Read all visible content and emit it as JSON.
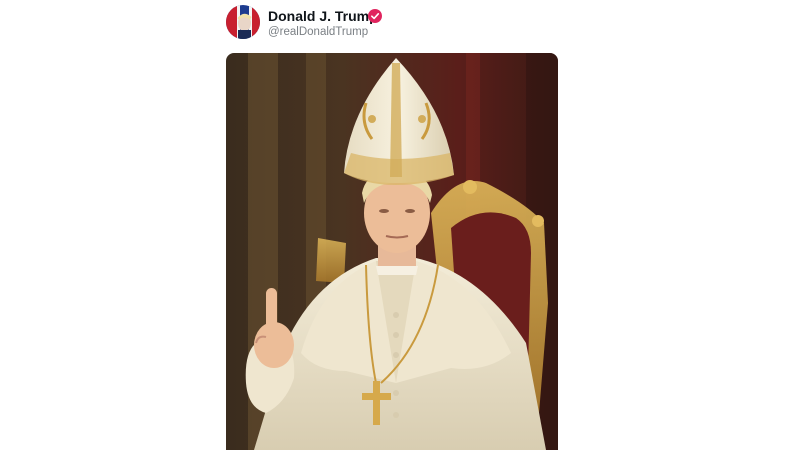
{
  "post": {
    "author": {
      "display_name": "Donald J. Trump",
      "handle": "@realDonaldTrump",
      "verified_badge_icon": "verified-badge-icon",
      "badge_color": "#e0245e",
      "avatar_colors": {
        "red": "#c8202f",
        "blue": "#1d3c8f",
        "white": "#f4f4f4"
      }
    },
    "media": {
      "type": "image",
      "icon": "portrait-image"
    }
  }
}
